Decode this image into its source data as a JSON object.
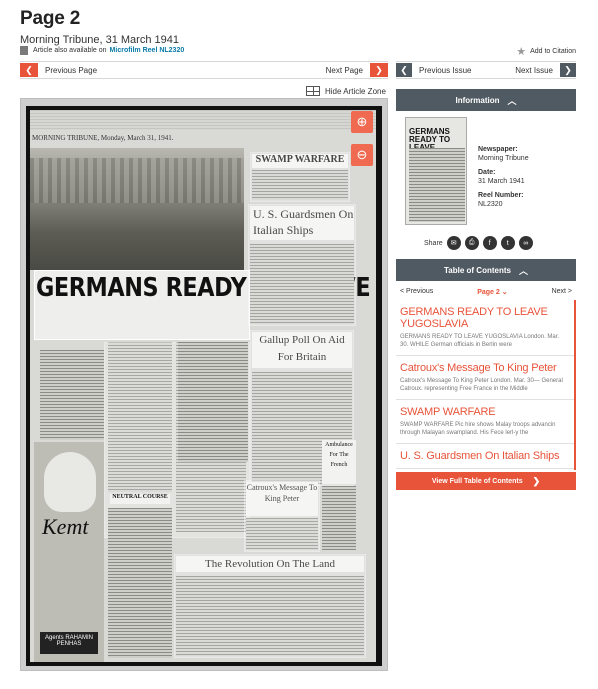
{
  "header": {
    "title": "Page 2",
    "subtitle": "Morning Tribune, 31 March 1941",
    "availability_text": "Article also available on",
    "microfilm_link": "Microfilm Reel NL2320",
    "cite_label": "Add to Citation"
  },
  "nav": {
    "previous_page": "Previous Page",
    "next_page": "Next Page",
    "previous_issue": "Previous Issue",
    "next_issue": "Next Issue",
    "prev_arrow": "❮",
    "next_arrow": "❯"
  },
  "viewer": {
    "hide_zone_label": "Hide Article Zone",
    "zoom_in_icon": "zoom-in-icon",
    "zoom_out_icon": "zoom-out-icon",
    "masthead": "MORNING TRIBUNE, Monday, March 31, 1941.",
    "headline_main": "GERMANS READY TO LEAVE YUGOSLAVIA",
    "headline_swamp": "SWAMP WARFARE",
    "headline_guardsmen": "U. S. Guardsmen On Italian Ships",
    "headline_gallup": "Gallup Poll On Aid For Britain",
    "headline_catroux": "Catroux's Message To King Peter",
    "headline_ambulance": "Ambulance For The French",
    "headline_revolution": "The Revolution On The Land",
    "headline_neutral": "NEUTRAL COURSE",
    "ad_brand": "Kemt",
    "ad_agents": "Agents RAHAMIN PENHAS"
  },
  "info": {
    "header": "Information",
    "newspaper_label": "Newspaper:",
    "newspaper_value": "Morning Tribune",
    "date_label": "Date:",
    "date_value": "31 March 1941",
    "reel_label": "Reel Number:",
    "reel_value": "NL2320",
    "share_label": "Share",
    "thumb_headline": "GERMANS READY TO LEAVE YUGOSLAVIA"
  },
  "toc": {
    "header": "Table of Contents",
    "prev": "< Previous",
    "page": "Page 2",
    "next": "Next >",
    "items": [
      {
        "title": "GERMANS READY TO LEAVE YUGOSLAVIA",
        "desc": "GERMANS READY TO LEAVE YUGOSLAVIA London. Mar. 30. WHILE German officials in Berlin were"
      },
      {
        "title": "Catroux's Message To King Peter",
        "desc": "Catroux's Message To King Peter London. Mar. 30— General Catroux. representing Free France in the Middle"
      },
      {
        "title": "SWAMP WARFARE",
        "desc": "SWAMP WARFARE Pic hire shows Malay troops advancin through Malayan swampland. His Fece lerl-y the"
      },
      {
        "title": "U. S. Guardsmen On Italian Ships",
        "desc": ""
      }
    ],
    "button": "View Full Table of Contents"
  },
  "colors": {
    "accent": "#e8543a",
    "dark_bar": "#505a63",
    "link": "#0a7aa8"
  }
}
